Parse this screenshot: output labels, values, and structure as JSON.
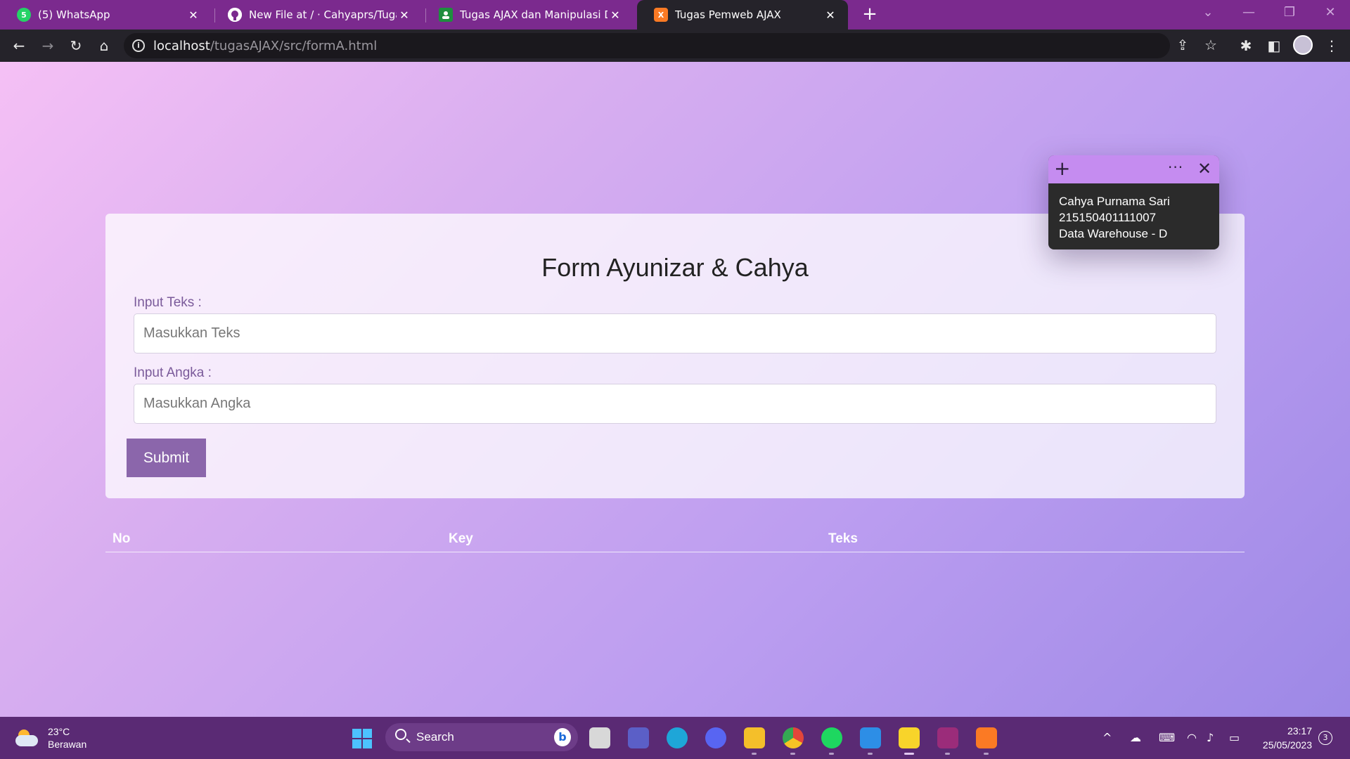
{
  "browser": {
    "tabs": [
      {
        "title": "(5) WhatsApp",
        "favicon": "whatsapp-icon",
        "color": "#25d366",
        "glyph": "5"
      },
      {
        "title": "New File at / · Cahyaprs/Tugas-Pe",
        "favicon": "github-icon",
        "color": "#ffffff",
        "glyph": ""
      },
      {
        "title": "Tugas AJAX dan Manipulasi DOM",
        "favicon": "classroom-icon",
        "color": "#1e8e3e",
        "glyph": ""
      },
      {
        "title": "Tugas Pemweb AJAX",
        "favicon": "xampp-icon",
        "color": "#fb7a24",
        "glyph": "X"
      }
    ],
    "active_tab": 3,
    "url_host": "localhost",
    "url_path": "/tugasAJAX/src/formA.html"
  },
  "form": {
    "title": "Form Ayunizar & Cahya",
    "text_label": "Input Teks :",
    "text_placeholder": "Masukkan Teks",
    "text_value": "",
    "number_label": "Input Angka :",
    "number_placeholder": "Masukkan Angka",
    "number_value": "",
    "submit_label": "Submit"
  },
  "table": {
    "columns": [
      "No",
      "Key",
      "Teks"
    ]
  },
  "sticky_note": {
    "lines": [
      "Cahya Purnama Sari",
      "215150401111007",
      "Data Warehouse - D"
    ],
    "accent": "#c58cf0"
  },
  "taskbar": {
    "weather_temp": "23°C",
    "weather_desc": "Berawan",
    "search_label": "Search",
    "clock_time": "23:17",
    "clock_date": "25/05/2023",
    "notification_count": "3",
    "apps": [
      {
        "name": "task-view-icon",
        "color": "#d8d8d8"
      },
      {
        "name": "meet-icon",
        "color": "#5b5fc7"
      },
      {
        "name": "edge-icon",
        "color": "#1ea6d8"
      },
      {
        "name": "discord-icon",
        "color": "#5865f2"
      },
      {
        "name": "file-explorer-icon",
        "color": "#f4bf2a"
      },
      {
        "name": "chrome-icon",
        "color": "#e3463a"
      },
      {
        "name": "spotify-icon",
        "color": "#1ed760"
      },
      {
        "name": "vscode-icon",
        "color": "#2d8ee6"
      },
      {
        "name": "sticky-notes-icon",
        "color": "#f8d42a"
      },
      {
        "name": "winrar-icon",
        "color": "#9b2c7a"
      },
      {
        "name": "xampp-icon",
        "color": "#fb7a24"
      }
    ]
  }
}
